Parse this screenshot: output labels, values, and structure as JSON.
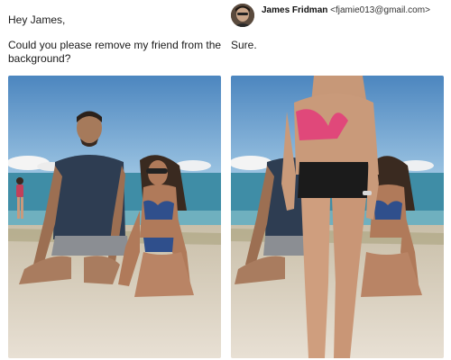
{
  "request_post": {
    "greeting": "Hey James,",
    "request_text": "Could you please remove my friend from the background?"
  },
  "reply_post": {
    "author_name": "James Fridman",
    "author_email": "<fjamie013@gmail.com>",
    "reply_text": "Sure."
  },
  "colors": {
    "sky": "#5d97c8",
    "sea": "#3f8da6",
    "sand": "#ddd3c4",
    "tshirt": "#2e3d52",
    "bikini_pink": "#e0487a"
  }
}
